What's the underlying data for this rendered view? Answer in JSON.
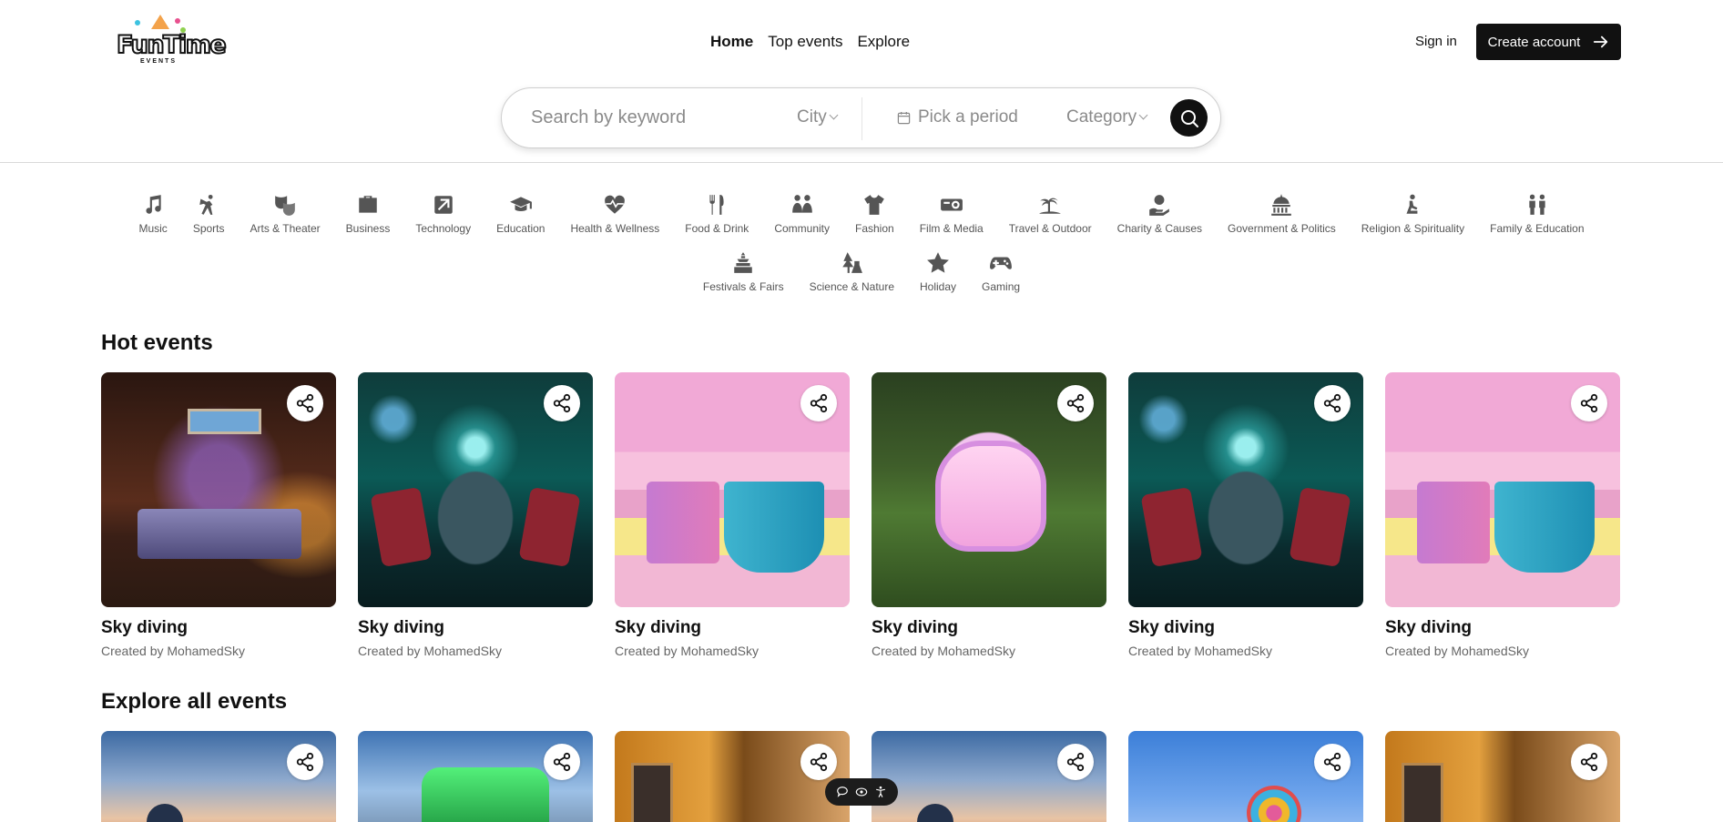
{
  "brand": {
    "name": "FunTime",
    "sub": "EVENTS"
  },
  "nav": {
    "home": "Home",
    "top_events": "Top events",
    "explore": "Explore"
  },
  "auth": {
    "sign_in": "Sign in",
    "create_account": "Create account"
  },
  "search": {
    "keyword_placeholder": "Search by keyword",
    "city": "City",
    "period": "Pick a period",
    "category": "Category"
  },
  "categories_row1": [
    {
      "label": "Music",
      "icon": "music-icon"
    },
    {
      "label": "Sports",
      "icon": "sports-icon"
    },
    {
      "label": "Arts & Theater",
      "icon": "theater-masks-icon"
    },
    {
      "label": "Business",
      "icon": "briefcase-icon"
    },
    {
      "label": "Technology",
      "icon": "technology-icon"
    },
    {
      "label": "Education",
      "icon": "graduation-cap-icon"
    },
    {
      "label": "Health & Wellness",
      "icon": "heartbeat-icon"
    },
    {
      "label": "Food & Drink",
      "icon": "utensils-icon"
    },
    {
      "label": "Community",
      "icon": "community-icon"
    },
    {
      "label": "Fashion",
      "icon": "tshirt-icon"
    },
    {
      "label": "Film & Media",
      "icon": "projector-icon"
    },
    {
      "label": "Travel & Outdoor",
      "icon": "island-icon"
    },
    {
      "label": "Charity & Causes",
      "icon": "charity-icon"
    },
    {
      "label": "Government & Politics",
      "icon": "landmark-icon"
    },
    {
      "label": "Religion & Spirituality",
      "icon": "prayer-icon"
    },
    {
      "label": "Family & Education",
      "icon": "family-icon"
    }
  ],
  "categories_row2": [
    {
      "label": "Festivals & Fairs",
      "icon": "festival-icon"
    },
    {
      "label": "Science & Nature",
      "icon": "science-nature-icon"
    },
    {
      "label": "Holiday",
      "icon": "star-icon"
    },
    {
      "label": "Gaming",
      "icon": "gamepad-icon"
    }
  ],
  "hot_events": {
    "title": "Hot events",
    "items": [
      {
        "title": "Sky diving",
        "by": "Created by MohamedSky"
      },
      {
        "title": "Sky diving",
        "by": "Created by MohamedSky"
      },
      {
        "title": "Sky diving",
        "by": "Created by MohamedSky"
      },
      {
        "title": "Sky diving",
        "by": "Created by MohamedSky"
      },
      {
        "title": "Sky diving",
        "by": "Created by MohamedSky"
      },
      {
        "title": "Sky diving",
        "by": "Created by MohamedSky"
      }
    ]
  },
  "explore_all": {
    "title": "Explore all events"
  }
}
